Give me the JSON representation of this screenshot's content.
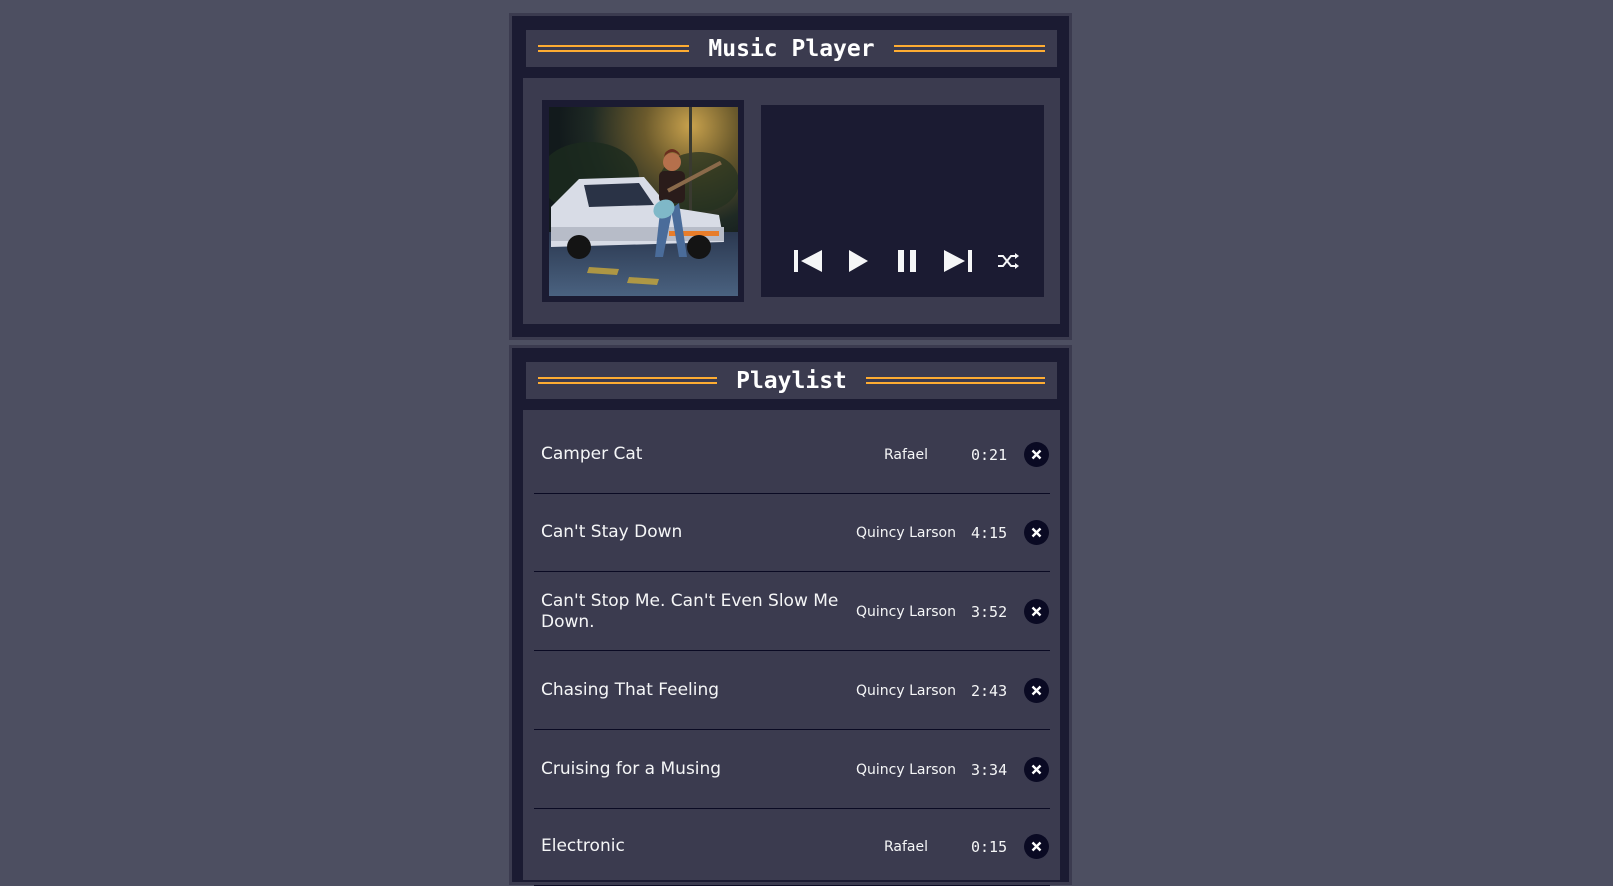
{
  "player": {
    "title": "Music Player",
    "album_art_icon": "album-cover-illustration",
    "controls": [
      {
        "name": "previous",
        "icon": "skip-previous-icon"
      },
      {
        "name": "play",
        "icon": "play-icon"
      },
      {
        "name": "pause",
        "icon": "pause-icon"
      },
      {
        "name": "next",
        "icon": "skip-next-icon"
      },
      {
        "name": "shuffle",
        "icon": "shuffle-icon"
      }
    ]
  },
  "playlist": {
    "title": "Playlist",
    "songs": [
      {
        "title": "Camper Cat",
        "artist": "Rafael",
        "duration": "0:21"
      },
      {
        "title": "Can't Stay Down",
        "artist": "Quincy Larson",
        "duration": "4:15"
      },
      {
        "title": "Can't Stop Me. Can't Even Slow Me Down.",
        "artist": "Quincy Larson",
        "duration": "3:52"
      },
      {
        "title": "Chasing That Feeling",
        "artist": "Quincy Larson",
        "duration": "2:43"
      },
      {
        "title": "Cruising for a Musing",
        "artist": "Quincy Larson",
        "duration": "3:34"
      },
      {
        "title": "Electronic",
        "artist": "Rafael",
        "duration": "0:15"
      }
    ],
    "delete_icon": "close-icon"
  },
  "colors": {
    "background": "#4d4f61",
    "panel": "#1b1b32",
    "panel_inner": "#3b3b4f",
    "accent": "#feac32",
    "text": "#ffffff"
  }
}
